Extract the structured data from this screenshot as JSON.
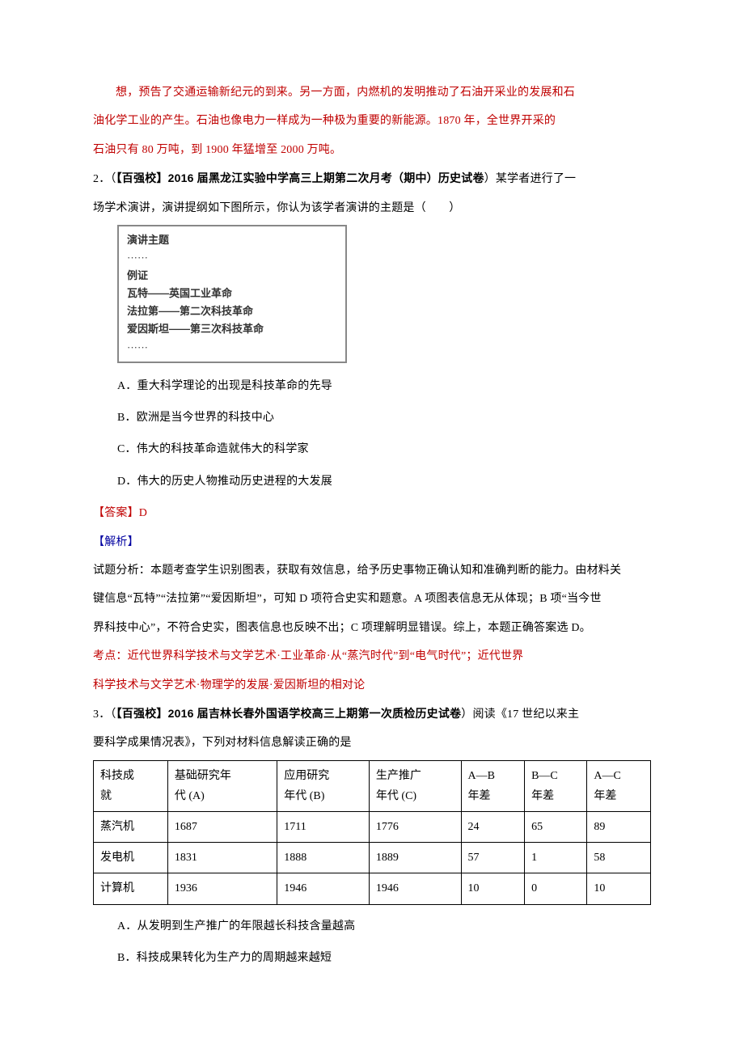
{
  "top": {
    "l1": "想，预告了交通运输新纪元的到来。另一方面，内燃机的发明推动了石油开采业的发展和石",
    "l2": "油化学工业的产生。石油也像电力一样成为一种极为重要的新能源。1870 年，全世界开采的",
    "l3": "石油只有 80 万吨，到 1900 年猛增至 2000 万吨。"
  },
  "q2": {
    "num": "2．（",
    "src": "【百强校】2016 届黑龙江实验中学高三上期第二次月考（期中）历史试卷",
    "tail1": "）某学者进行了一",
    "tail2": "场学术演讲，演讲提纲如下图所示，你认为该学者演讲的主题是（　　）",
    "box": {
      "title": "演讲主题",
      "dots1": "······",
      "row1": "例证",
      "row2": "瓦特——英国工业革命",
      "row3": "法拉第——第二次科技革命",
      "row4": "爱因斯坦——第三次科技革命",
      "dots2": "······"
    },
    "A": "A．重大科学理论的出现是科技革命的先导",
    "B": "B．欧洲是当今世界的科技中心",
    "C": "C．伟大的科技革命造就伟大的科学家",
    "D": "D．伟大的历史人物推动历史进程的大发展",
    "ans": "【答案】D",
    "jiexi": "【解析】",
    "jx_lines": [
      "试题分析：本题考查学生识别图表，获取有效信息，给予历史事物正确认知和准确判断的能力。由材料关",
      "键信息“瓦特”“法拉第”“爱因斯坦”，可知 D 项符合史实和题意。A 项图表信息无从体现；B 项“当今世",
      "界科技中心”，不符合史实，图表信息也反映不出；C 项理解明显错误。综上，本题正确答案选 D。"
    ],
    "kd1": "考点：近代世界科学技术与文学艺术·工业革命·从“蒸汽时代”到“电气时代”；近代世界",
    "kd2": "科学技术与文学艺术·物理学的发展·爱因斯坦的相对论"
  },
  "q3": {
    "num": "3．（",
    "src": "【百强校】2016 届吉林长春外国语学校高三上期第一次质检历史试卷",
    "tail1": "）阅读《17 世纪以来主",
    "tail2": "要科学成果情况表》，下列对材料信息解读正确的是",
    "table": {
      "header": {
        "c1a": "科技成",
        "c1b": "就",
        "c2a": "基础研究年",
        "c2b": "代 (A)",
        "c3a": "应用研究",
        "c3b": "年代 (B)",
        "c4a": "生产推广",
        "c4b": "年代 (C)",
        "c5a": "A—B",
        "c5b": "年差",
        "c6a": "B—C",
        "c6b": "年差",
        "c7a": "A—C",
        "c7b": "年差"
      },
      "rows": [
        {
          "c1": "蒸汽机",
          "c2": "1687",
          "c3": "1711",
          "c4": "1776",
          "c5": "24",
          "c6": "65",
          "c7": "89"
        },
        {
          "c1": "发电机",
          "c2": "1831",
          "c3": "1888",
          "c4": "1889",
          "c5": "57",
          "c6": "1",
          "c7": "58"
        },
        {
          "c1": "计算机",
          "c2": "1936",
          "c3": "1946",
          "c4": "1946",
          "c5": "10",
          "c6": "0",
          "c7": "10"
        }
      ]
    },
    "A": "A．从发明到生产推广的年限越长科技含量越高",
    "B": "B．科技成果转化为生产力的周期越来越短"
  },
  "chart_data": {
    "type": "table",
    "title": "17 世纪以来主要科学成果情况表",
    "columns": [
      "科技成就",
      "基础研究年代 (A)",
      "应用研究年代 (B)",
      "生产推广年代 (C)",
      "A—B 年差",
      "B—C 年差",
      "A—C 年差"
    ],
    "rows": [
      [
        "蒸汽机",
        1687,
        1711,
        1776,
        24,
        65,
        89
      ],
      [
        "发电机",
        1831,
        1888,
        1889,
        57,
        1,
        58
      ],
      [
        "计算机",
        1936,
        1946,
        1946,
        10,
        0,
        10
      ]
    ]
  }
}
